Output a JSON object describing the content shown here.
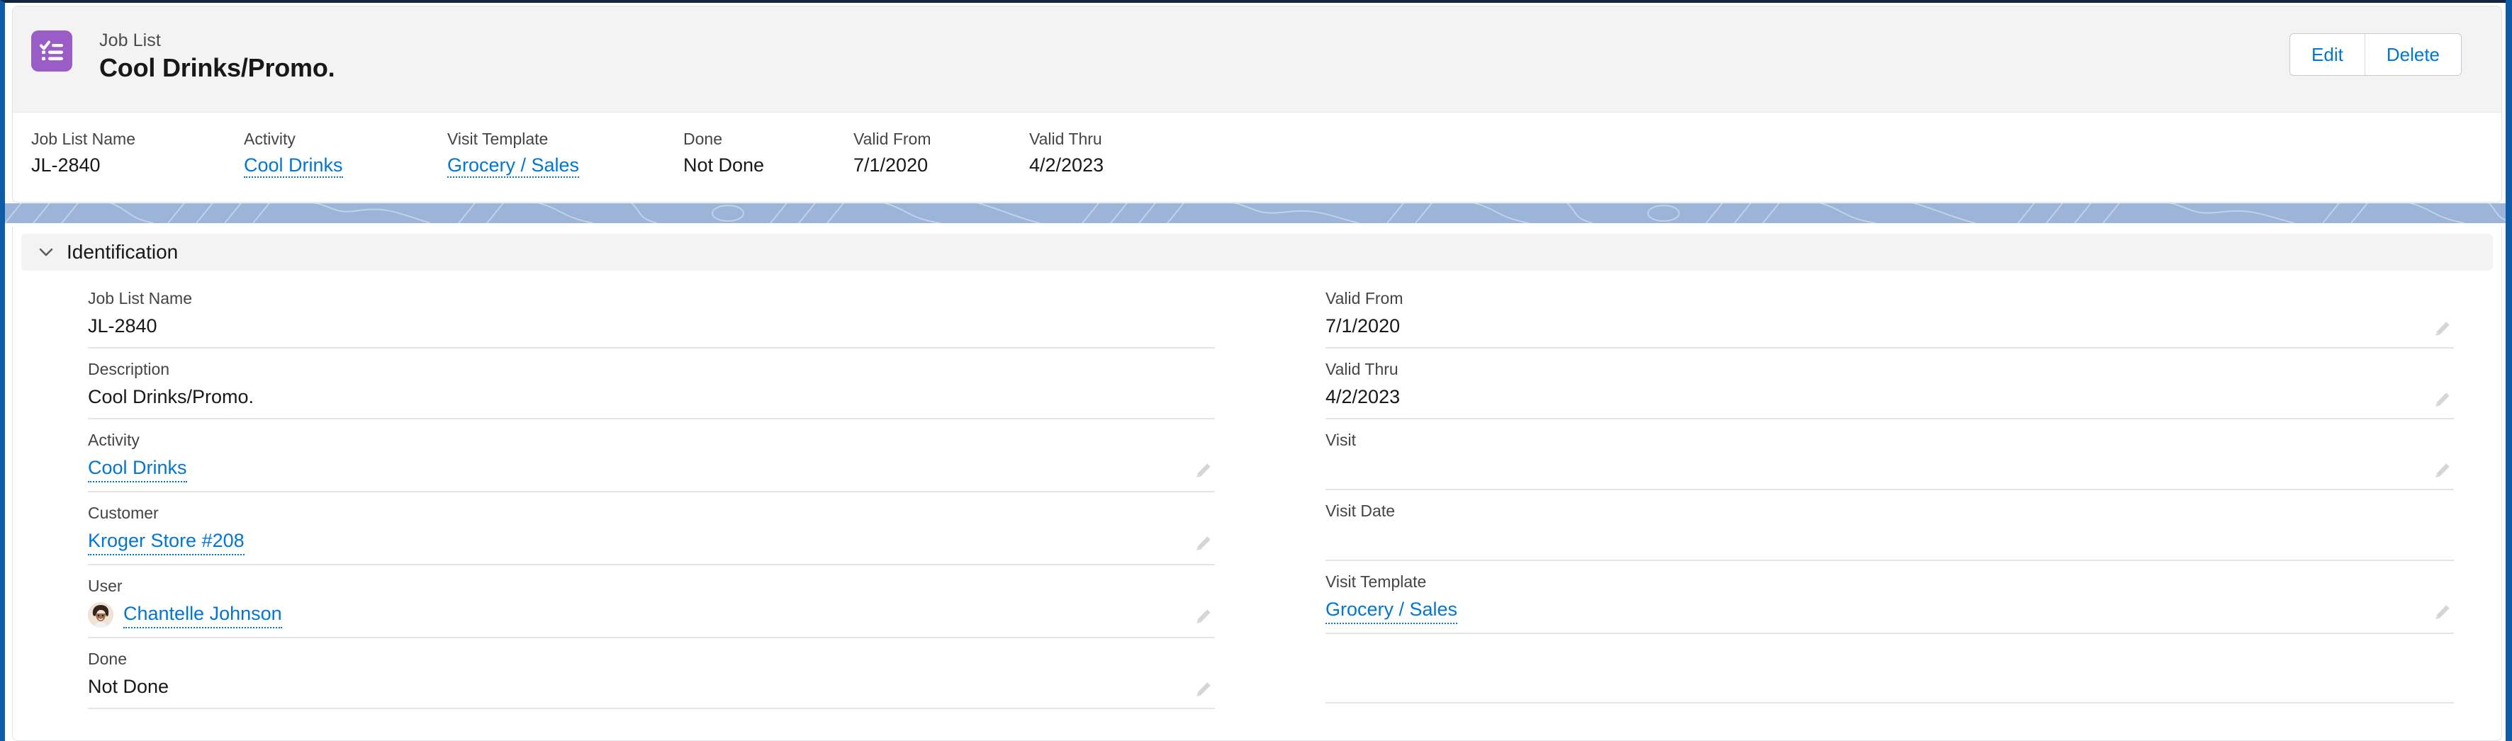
{
  "header": {
    "icon": "checklist-icon",
    "icon_color": "#9a5cc6",
    "object_label": "Job List",
    "record_title": "Cool Drinks/Promo.",
    "actions": [
      {
        "label": "Edit",
        "name": "edit-button"
      },
      {
        "label": "Delete",
        "name": "delete-button"
      }
    ]
  },
  "highlights": [
    {
      "label": "Job List Name",
      "value": "JL-2840",
      "is_link": false
    },
    {
      "label": "Activity",
      "value": "Cool Drinks",
      "is_link": true
    },
    {
      "label": "Visit Template",
      "value": "Grocery / Sales",
      "is_link": true
    },
    {
      "label": "Done",
      "value": "Not Done",
      "is_link": false
    },
    {
      "label": "Valid From",
      "value": "7/1/2020",
      "is_link": false
    },
    {
      "label": "Valid Thru",
      "value": "4/2/2023",
      "is_link": false
    }
  ],
  "section": {
    "title": "Identification",
    "expanded": true,
    "chevron": "chevron-down-icon"
  },
  "fields": {
    "left": [
      {
        "label": "Job List Name",
        "value": "JL-2840",
        "is_link": false,
        "has_avatar": false,
        "editable": false
      },
      {
        "label": "Description",
        "value": "Cool Drinks/Promo.",
        "is_link": false,
        "has_avatar": false,
        "editable": false
      },
      {
        "label": "Activity",
        "value": "Cool Drinks",
        "is_link": true,
        "has_avatar": false,
        "editable": true
      },
      {
        "label": "Customer",
        "value": "Kroger Store #208",
        "is_link": true,
        "has_avatar": false,
        "editable": true
      },
      {
        "label": "User",
        "value": "Chantelle Johnson",
        "is_link": true,
        "has_avatar": true,
        "editable": true
      },
      {
        "label": "Done",
        "value": "Not Done",
        "is_link": false,
        "has_avatar": false,
        "editable": true
      }
    ],
    "right": [
      {
        "label": "Valid From",
        "value": "7/1/2020",
        "is_link": false,
        "has_avatar": false,
        "editable": true
      },
      {
        "label": "Valid Thru",
        "value": "4/2/2023",
        "is_link": false,
        "has_avatar": false,
        "editable": true
      },
      {
        "label": "Visit",
        "value": "",
        "is_link": false,
        "has_avatar": false,
        "editable": true
      },
      {
        "label": "Visit Date",
        "value": "",
        "is_link": false,
        "has_avatar": false,
        "editable": false
      },
      {
        "label": "Visit Template",
        "value": "Grocery / Sales",
        "is_link": true,
        "has_avatar": false,
        "editable": true
      },
      {
        "label": "",
        "value": "",
        "is_link": false,
        "has_avatar": false,
        "editable": false
      }
    ]
  },
  "colors": {
    "link": "#0176d3",
    "brand_icon": "#9a5cc6",
    "banner": "#9cb4d8",
    "frame": "#0e5ca8",
    "section_bg": "#f3f3f3"
  }
}
